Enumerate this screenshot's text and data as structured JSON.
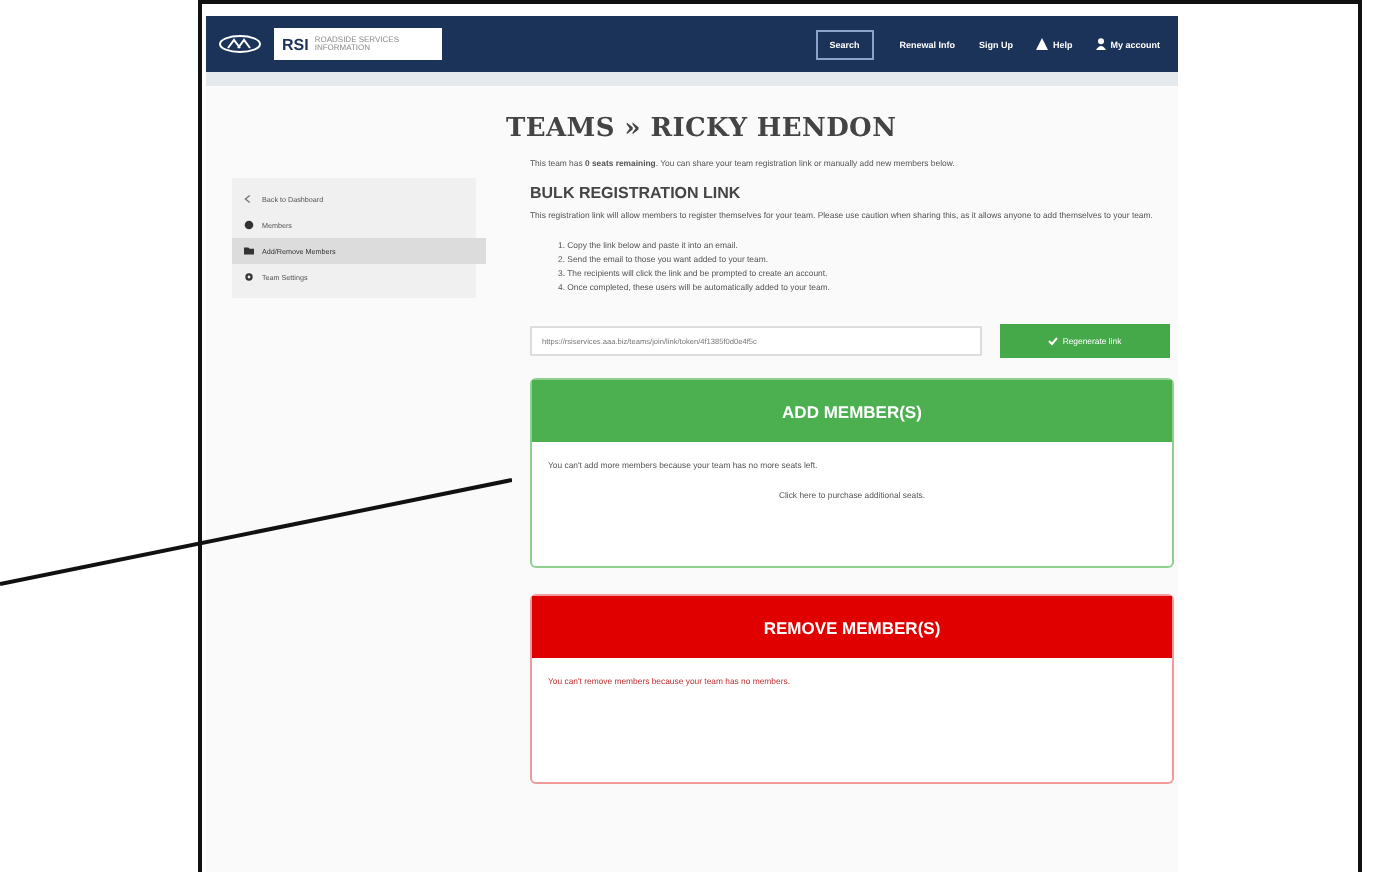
{
  "nav": {
    "logo_text": "RSI",
    "logo_subtitle": "ROADSIDE SERVICES INFORMATION",
    "items": [
      {
        "label": "Search",
        "kind": "outlined"
      },
      {
        "label": "Renewal Info",
        "kind": "plain"
      },
      {
        "label": "Sign Up",
        "kind": "plain"
      },
      {
        "label": "Help",
        "kind": "warning"
      },
      {
        "label": "My account",
        "kind": "user"
      }
    ]
  },
  "sidebar": {
    "items": [
      {
        "label": "Back to Dashboard",
        "kind": "back",
        "selected": false
      },
      {
        "label": "Members",
        "kind": "members",
        "selected": false
      },
      {
        "label": "Add/Remove Members",
        "kind": "add",
        "selected": true
      },
      {
        "label": "Team Settings",
        "kind": "settings",
        "selected": false
      }
    ]
  },
  "title": "TEAMS » RICKY HENDON",
  "intro": "This team has **0 seats remaining**. You can share your team registration link or manually add new members below.",
  "bulk": {
    "heading": "BULK REGISTRATION LINK",
    "description": "This registration link will allow members to register themselves for your team. Please use caution when sharing this, as it allows anyone to add themselves to your team.",
    "steps": [
      "1. Copy the link below and paste it into an email.",
      "2. Send the email to those you want added to your team.",
      "3. The recipients will click the link and be prompted to create an account.",
      "4. Once completed, these users will be automatically added to your team."
    ],
    "link": "https://rsiservices.aaa.biz/teams/join/link/token/4f1385f0d0e4f5c",
    "button": "Regenerate link"
  },
  "panels": [
    {
      "kind": "add",
      "heading": "ADD MEMBER(S)",
      "lines": [
        "You can't add more members because your team has no more seats left.",
        "Click here to purchase additional seats."
      ]
    },
    {
      "kind": "remove",
      "heading": "REMOVE MEMBER(S)",
      "lines": [
        "You can't remove members because your team has no members."
      ]
    }
  ]
}
